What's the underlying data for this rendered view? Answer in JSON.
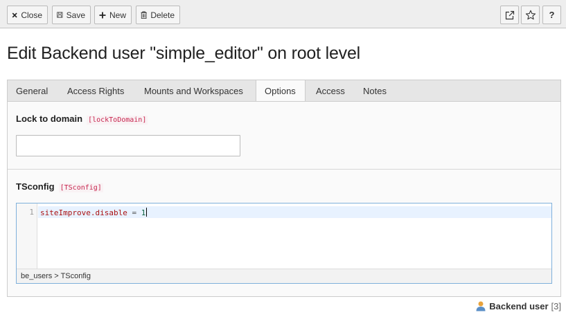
{
  "toolbar": {
    "close_label": "Close",
    "save_label": "Save",
    "new_label": "New",
    "delete_label": "Delete",
    "help_label": "?"
  },
  "page_title": "Edit Backend user \"simple_editor\" on root level",
  "tabs": [
    {
      "label": "General"
    },
    {
      "label": "Access Rights"
    },
    {
      "label": "Mounts and Workspaces"
    },
    {
      "label": "Options",
      "active": true
    },
    {
      "label": "Access"
    },
    {
      "label": "Notes"
    }
  ],
  "fields": {
    "lock_to_domain": {
      "label": "Lock to domain",
      "code": "[lockToDomain]",
      "value": ""
    },
    "tsconfig": {
      "label": "TSconfig",
      "code": "[TSconfig]",
      "line_number": "1",
      "code_prop": "siteImprove.disable",
      "code_op": " = ",
      "code_value": "1",
      "statusbar": "be_users > TSconfig"
    }
  },
  "footer": {
    "record_type": "Backend user",
    "record_id": "[3]"
  },
  "colors": {
    "accent_border": "#7fb0db",
    "code_tag": "#c7254e",
    "user_icon": "#e8a33d"
  },
  "icons": [
    "close-icon",
    "save-icon",
    "plus-icon",
    "trash-icon",
    "open-in-new-window-icon",
    "star-icon",
    "backend-user-icon"
  ]
}
